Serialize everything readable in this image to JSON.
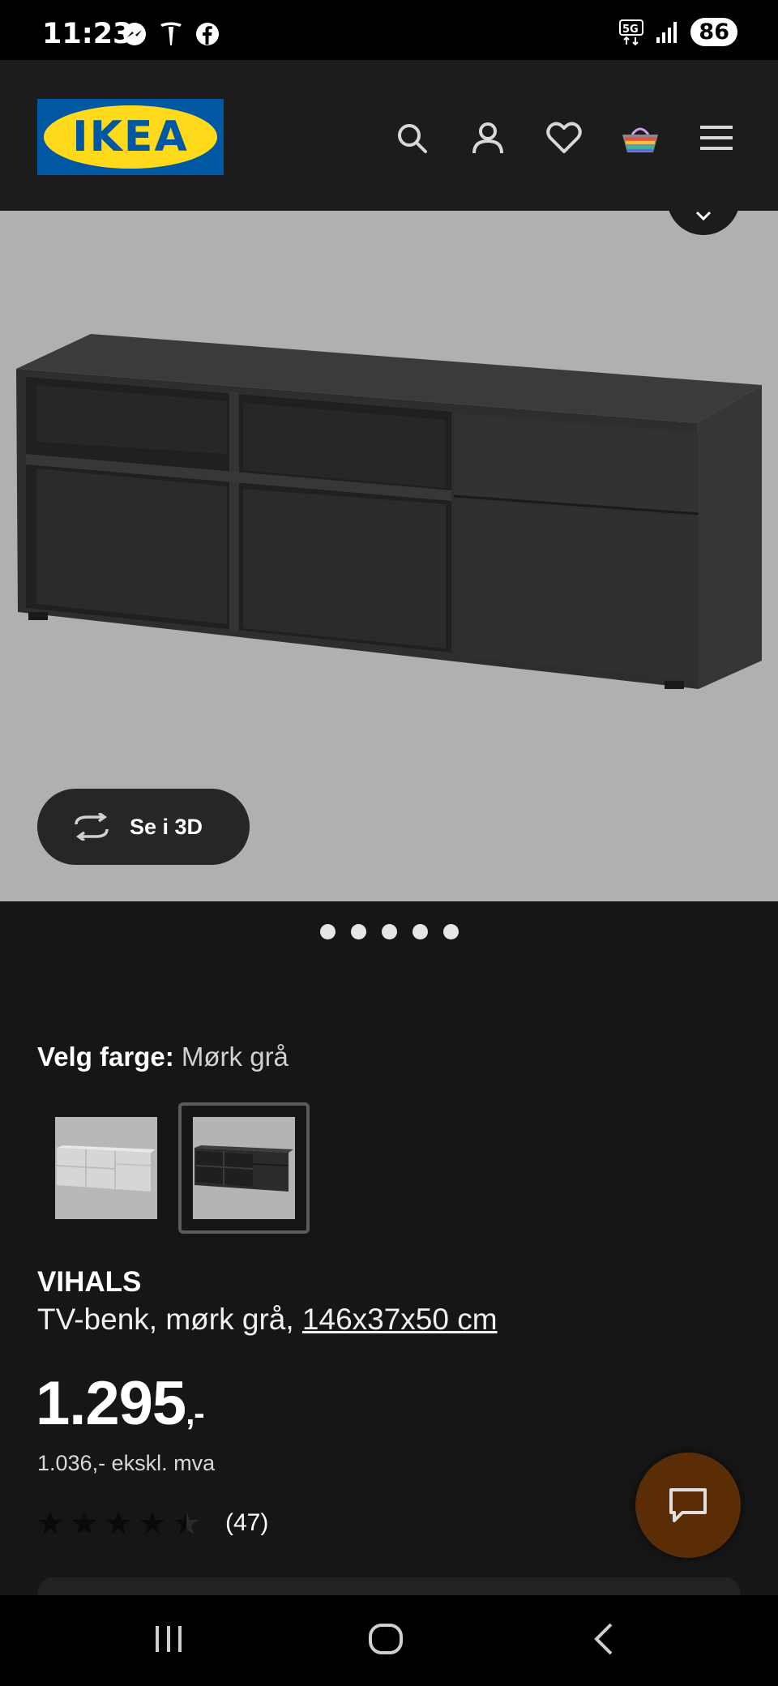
{
  "status_bar": {
    "time": "11:23",
    "network": "5G",
    "battery": "86"
  },
  "header": {
    "logo_text": "IKEA"
  },
  "hero": {
    "view3d_label": "Se i 3D",
    "dot_count": 5
  },
  "color_selector": {
    "label": "Velg farge:",
    "value": "Mørk grå"
  },
  "product": {
    "name": "VIHALS",
    "description": "TV-benk, mørk grå,",
    "dimensions": "146x37x50 cm",
    "price": "1.295",
    "price_suffix": ",-",
    "price_ex_vat": "1.036,- ekskl. mva",
    "rating_value": 4.5,
    "rating_max": 5,
    "rating_count": "(47)"
  },
  "colors": {
    "accent_chat": "#5a2d06",
    "logo_blue": "#0058a3",
    "logo_yellow": "#ffda1a"
  }
}
